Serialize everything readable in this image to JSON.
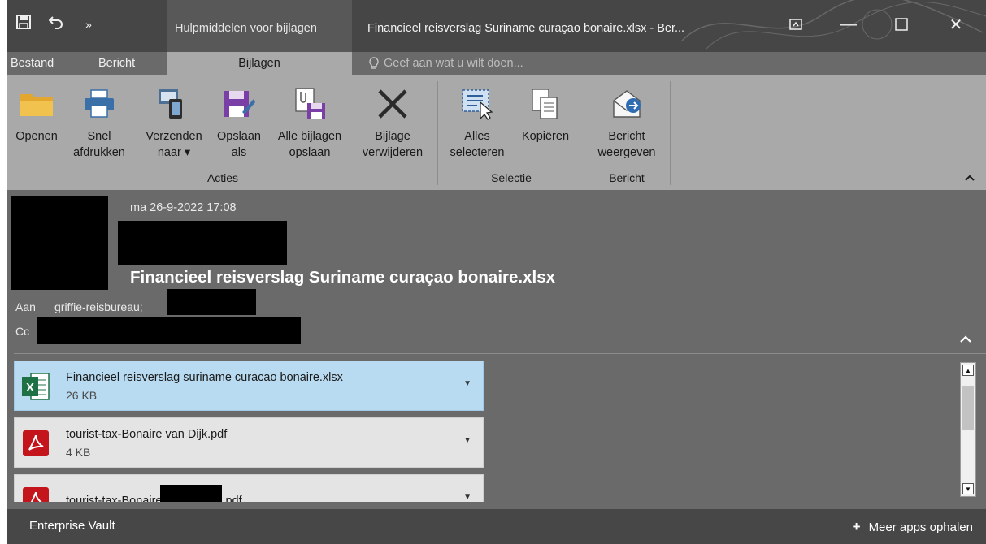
{
  "title_bar": {
    "context_label": "Hulpmiddelen voor bijlagen",
    "title": "Financieel reisverslag Suriname curaçao bonaire.xlsx - Ber...",
    "icons": [
      "save-icon",
      "undo-icon",
      "more-icon",
      "ribbon-display-icon",
      "minimize-icon",
      "maximize-icon",
      "close-icon"
    ],
    "close_glyph": "✕",
    "minimize_glyph": "—",
    "more_glyph": "»"
  },
  "tabs": {
    "items": [
      "Bestand",
      "Bericht",
      "Bijlagen"
    ],
    "active": "Bijlagen",
    "tell_me": "Geef aan wat u wilt doen..."
  },
  "ribbon": {
    "buttons": {
      "openen": "Openen",
      "snel": "Snel\nafdrukken",
      "verzenden": "Verzenden\nnaar ▾",
      "opslaan_als": "Opslaan\nals",
      "alle_bijlagen": "Alle bijlagen\nopslaan",
      "verwijderen": "Bijlage\nverwijderen",
      "alles": "Alles\nselecteren",
      "kopieren": "Kopiëren",
      "bericht": "Bericht\nweergeven"
    },
    "groups": [
      "Acties",
      "Selectie",
      "Bericht"
    ]
  },
  "header": {
    "date": "ma 26-9-2022 17:08",
    "subject": "Financieel reisverslag Suriname curaçao bonaire.xlsx",
    "to_label": "Aan",
    "to_value": "griffie-reisbureau;",
    "cc_label": "Cc"
  },
  "attachments": [
    {
      "name": "Financieel reisverslag suriname curacao bonaire.xlsx",
      "size": "26 KB",
      "type": "excel",
      "selected": true
    },
    {
      "name": "tourist-tax-Bonaire van Dijk.pdf",
      "size": "4 KB",
      "type": "pdf",
      "selected": false
    },
    {
      "name_prefix": "tourist-tax-Bonaire",
      "name_suffix": ".pdf",
      "type": "pdf",
      "selected": false
    }
  ],
  "bottom": {
    "vault": "Enterprise Vault",
    "more_apps": "Meer apps ophalen"
  },
  "colors": {
    "title_bar": "#464646",
    "ribbon": "#a9a9a9",
    "body": "#6a6a6a",
    "selected_attachment": "#b8dbf1",
    "excel_green": "#1e7145",
    "pdf_red": "#c4151c"
  }
}
